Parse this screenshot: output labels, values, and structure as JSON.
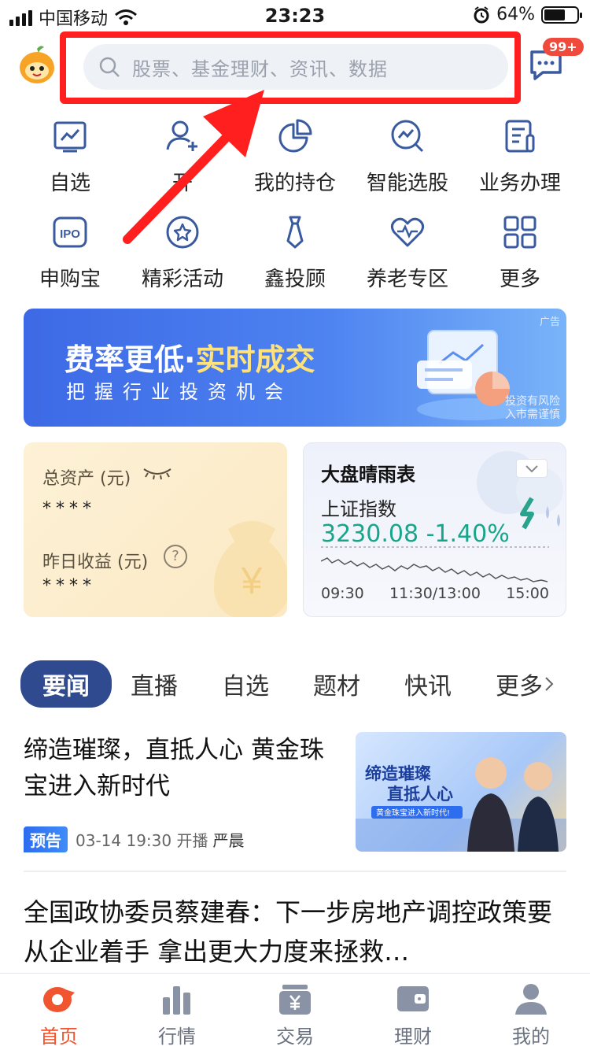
{
  "status_bar": {
    "carrier": "中国移动",
    "time": "23:23",
    "battery_percent": "64%",
    "battery_level": 0.64
  },
  "header": {
    "search_placeholder": "股票、基金理财、资讯、数据",
    "message_badge": "99+"
  },
  "grid": {
    "row1": [
      {
        "label": "自选",
        "icon": "line-chart-icon"
      },
      {
        "label": "开",
        "icon": "add-user-icon"
      },
      {
        "label": "我的持仓",
        "icon": "pie-chart-icon"
      },
      {
        "label": "智能选股",
        "icon": "smart-pick-icon"
      },
      {
        "label": "业务办理",
        "icon": "business-doc-icon"
      }
    ],
    "row2": [
      {
        "label": "申购宝",
        "icon": "ipo-icon"
      },
      {
        "label": "精彩活动",
        "icon": "star-badge-icon"
      },
      {
        "label": "鑫投顾",
        "icon": "tie-icon"
      },
      {
        "label": "养老专区",
        "icon": "heart-pulse-icon"
      },
      {
        "label": "更多",
        "icon": "grid-more-icon"
      }
    ],
    "ipo_text": "IPO"
  },
  "banner": {
    "title_part1": "费率更低·",
    "title_part2": "实时成交",
    "subtitle": "把握行业投资机会",
    "ad_label": "广告",
    "risk_line1": "投资有风险",
    "risk_line2": "入市需谨慎"
  },
  "assets_card": {
    "total_label": "总资产 (元)",
    "total_value": "****",
    "yesterday_label": "昨日收益 (元)",
    "yesterday_value": "****",
    "help": "?",
    "yen": "¥"
  },
  "market_card": {
    "title": "大盘晴雨表",
    "index_name": "上证指数",
    "index_value": "3230.08 -1.40%",
    "ticks": [
      "09:30",
      "11:30/13:00",
      "15:00"
    ]
  },
  "news": {
    "tabs": [
      "要闻",
      "直播",
      "自选",
      "题材",
      "快讯",
      "更多"
    ],
    "article1": {
      "headline": "缔造璀璨，直抵人心  黄金珠宝进入新时代",
      "badge": "预告",
      "meta": "03-14 19:30 开播",
      "author": "严晨",
      "thumb_title1": "缔造璀璨",
      "thumb_title2": "直抵人心",
      "thumb_sub": "黄金珠宝进入新时代!"
    },
    "article2": {
      "headline": "全国政协委员蔡建春：下一步房地产调控政策要从企业着手 拿出更大力度来拯救…"
    }
  },
  "bottom_nav": [
    {
      "label": "首页",
      "icon": "home-icon",
      "active": true
    },
    {
      "label": "行情",
      "icon": "market-bars-icon",
      "active": false
    },
    {
      "label": "交易",
      "icon": "trade-wallet-icon",
      "active": false
    },
    {
      "label": "理财",
      "icon": "wealth-wallet-icon",
      "active": false
    },
    {
      "label": "我的",
      "icon": "profile-icon",
      "active": false
    }
  ],
  "colors": {
    "accent_orange": "#f0552f",
    "highlight_red": "#ff1f1f",
    "market_green": "#17a68a",
    "tab_active": "#2f4a8f",
    "icon_blue": "#3a5a9f"
  }
}
